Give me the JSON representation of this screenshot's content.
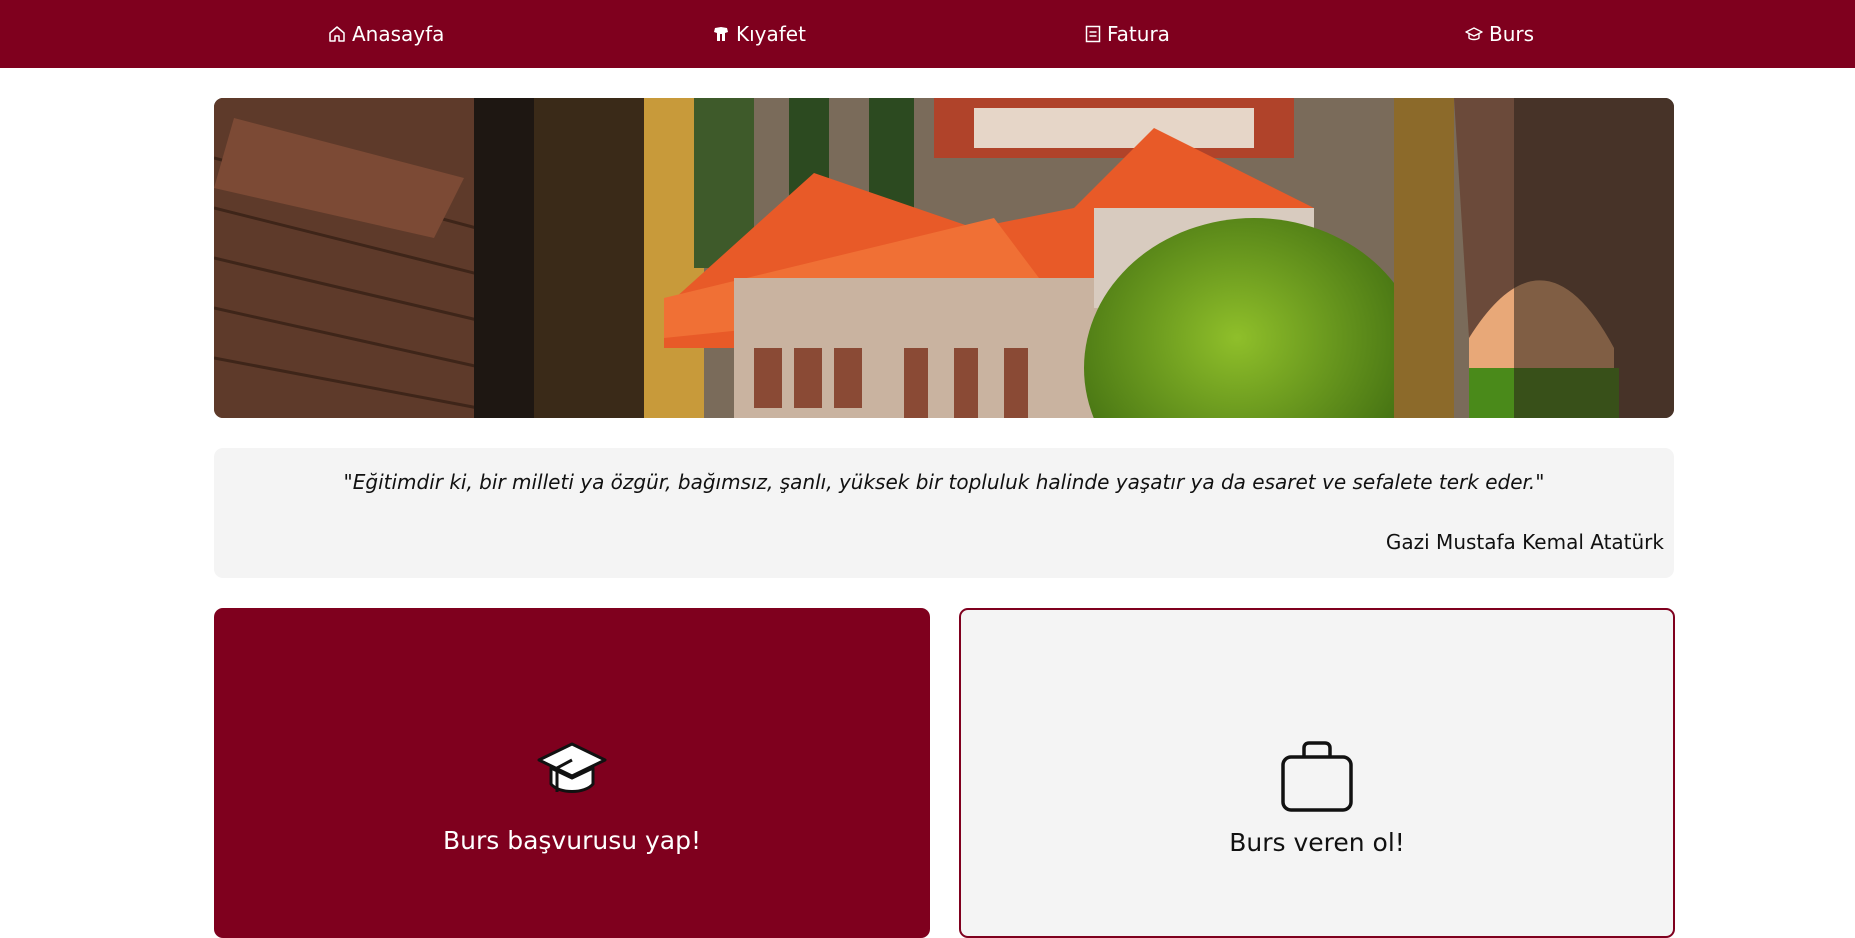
{
  "nav": {
    "items": [
      {
        "label": "Anasayfa",
        "icon": "home-icon"
      },
      {
        "label": "Kıyafet",
        "icon": "hanger-icon"
      },
      {
        "label": "Fatura",
        "icon": "invoice-icon"
      },
      {
        "label": "Burs",
        "icon": "graduation-cap-icon"
      }
    ],
    "background": "#7f001e"
  },
  "hero": {
    "image": "ottoman-architecture-banner"
  },
  "quote": {
    "text": "\"Eğitimdir ki, bir milleti ya özgür, bağımsız, şanlı, yüksek bir topluluk halinde yaşatır ya da esaret ve sefalete terk eder.\"",
    "author": "Gazi Mustafa Kemal Atatürk"
  },
  "cards": [
    {
      "label": "Burs başvurusu yap!",
      "icon": "graduation-cap-icon",
      "background": "#7f001e"
    },
    {
      "label": "Burs veren ol!",
      "icon": "briefcase-icon",
      "background": "#f4f4f4"
    }
  ],
  "colors": {
    "accent": "#7f001e",
    "panel": "#f4f4f4"
  }
}
